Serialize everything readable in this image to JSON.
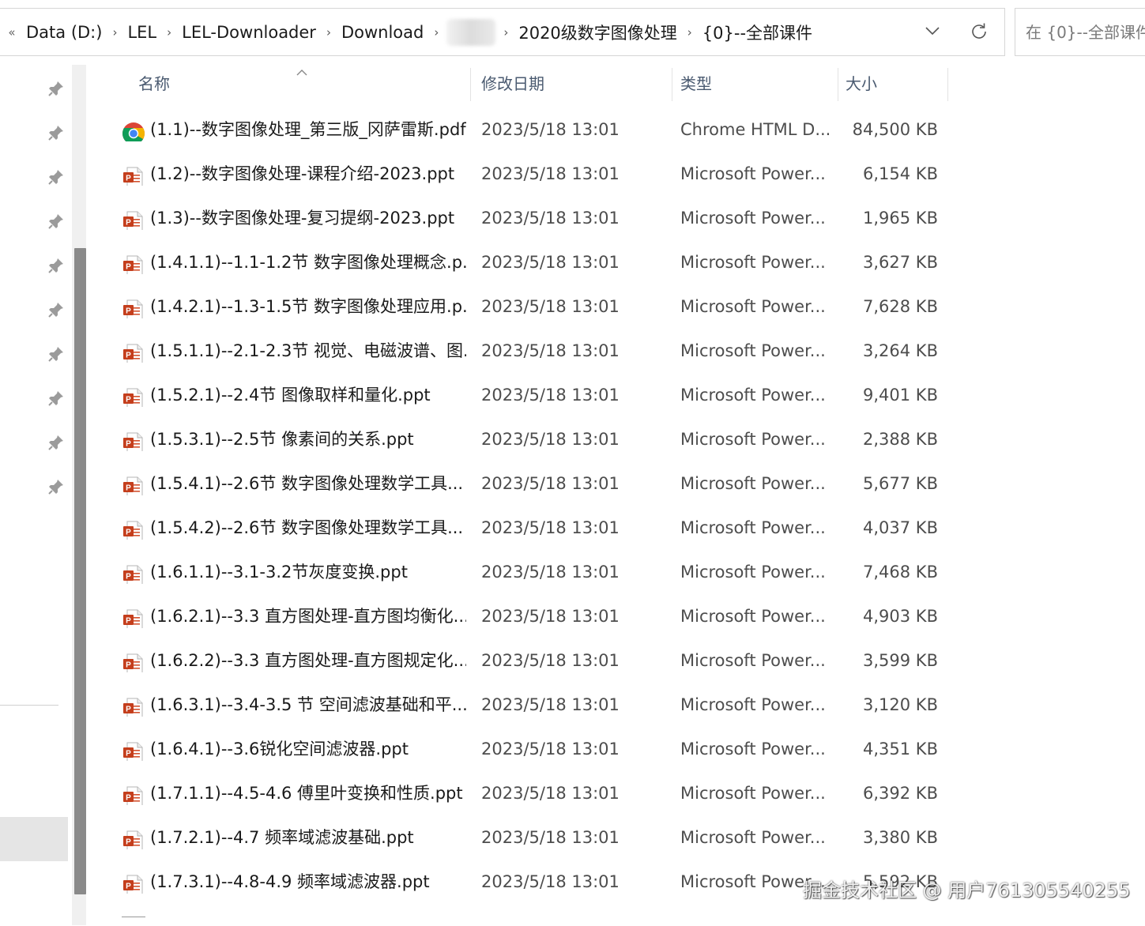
{
  "address_bar": {
    "crumbs": [
      "Data (D:)",
      "LEL",
      "LEL-Downloader",
      "Download",
      "",
      "2020级数字图像处理",
      "{0}--全部课件"
    ]
  },
  "search": {
    "placeholder": "在 {0}--全部课件"
  },
  "columns": {
    "name": "名称",
    "date": "修改日期",
    "type": "类型",
    "size": "大小"
  },
  "files": [
    {
      "icon": "chrome-pdf-icon",
      "name": "(1.1)--数字图像处理_第三版_冈萨雷斯.pdf",
      "date": "2023/5/18 13:01",
      "type": "Chrome HTML D...",
      "size": "84,500 KB"
    },
    {
      "icon": "powerpoint-file-icon",
      "name": "(1.2)--数字图像处理-课程介绍-2023.ppt",
      "date": "2023/5/18 13:01",
      "type": "Microsoft Power...",
      "size": "6,154 KB"
    },
    {
      "icon": "powerpoint-file-icon",
      "name": "(1.3)--数字图像处理-复习提纲-2023.ppt",
      "date": "2023/5/18 13:01",
      "type": "Microsoft Power...",
      "size": "1,965 KB"
    },
    {
      "icon": "powerpoint-file-icon",
      "name": "(1.4.1.1)--1.1-1.2节 数字图像处理概念.p...",
      "date": "2023/5/18 13:01",
      "type": "Microsoft Power...",
      "size": "3,627 KB"
    },
    {
      "icon": "powerpoint-file-icon",
      "name": "(1.4.2.1)--1.3-1.5节 数字图像处理应用.p...",
      "date": "2023/5/18 13:01",
      "type": "Microsoft Power...",
      "size": "7,628 KB"
    },
    {
      "icon": "powerpoint-file-icon",
      "name": "(1.5.1.1)--2.1-2.3节 视觉、电磁波谱、图...",
      "date": "2023/5/18 13:01",
      "type": "Microsoft Power...",
      "size": "3,264 KB"
    },
    {
      "icon": "powerpoint-file-icon",
      "name": "(1.5.2.1)--2.4节 图像取样和量化.ppt",
      "date": "2023/5/18 13:01",
      "type": "Microsoft Power...",
      "size": "9,401 KB"
    },
    {
      "icon": "powerpoint-file-icon",
      "name": "(1.5.3.1)--2.5节 像素间的关系.ppt",
      "date": "2023/5/18 13:01",
      "type": "Microsoft Power...",
      "size": "2,388 KB"
    },
    {
      "icon": "powerpoint-file-icon",
      "name": "(1.5.4.1)--2.6节 数字图像处理数学工具...",
      "date": "2023/5/18 13:01",
      "type": "Microsoft Power...",
      "size": "5,677 KB"
    },
    {
      "icon": "powerpoint-file-icon",
      "name": "(1.5.4.2)--2.6节 数字图像处理数学工具...",
      "date": "2023/5/18 13:01",
      "type": "Microsoft Power...",
      "size": "4,037 KB"
    },
    {
      "icon": "powerpoint-file-icon",
      "name": "(1.6.1.1)--3.1-3.2节灰度变换.ppt",
      "date": "2023/5/18 13:01",
      "type": "Microsoft Power...",
      "size": "7,468 KB"
    },
    {
      "icon": "powerpoint-file-icon",
      "name": "(1.6.2.1)--3.3 直方图处理-直方图均衡化....",
      "date": "2023/5/18 13:01",
      "type": "Microsoft Power...",
      "size": "4,903 KB"
    },
    {
      "icon": "powerpoint-file-icon",
      "name": "(1.6.2.2)--3.3 直方图处理-直方图规定化....",
      "date": "2023/5/18 13:01",
      "type": "Microsoft Power...",
      "size": "3,599 KB"
    },
    {
      "icon": "powerpoint-file-icon",
      "name": "(1.6.3.1)--3.4-3.5 节 空间滤波基础和平...",
      "date": "2023/5/18 13:01",
      "type": "Microsoft Power...",
      "size": "3,120 KB"
    },
    {
      "icon": "powerpoint-file-icon",
      "name": "(1.6.4.1)--3.6锐化空间滤波器.ppt",
      "date": "2023/5/18 13:01",
      "type": "Microsoft Power...",
      "size": "4,351 KB"
    },
    {
      "icon": "powerpoint-file-icon",
      "name": "(1.7.1.1)--4.5-4.6 傅里叶变换和性质.ppt",
      "date": "2023/5/18 13:01",
      "type": "Microsoft Power...",
      "size": "6,392 KB"
    },
    {
      "icon": "powerpoint-file-icon",
      "name": "(1.7.2.1)--4.7 频率域滤波基础.ppt",
      "date": "2023/5/18 13:01",
      "type": "Microsoft Power...",
      "size": "3,380 KB"
    },
    {
      "icon": "powerpoint-file-icon",
      "name": "(1.7.3.1)--4.8-4.9 频率域滤波器.ppt",
      "date": "2023/5/18 13:01",
      "type": "Microsoft Power...",
      "size": "5,592 KB"
    }
  ],
  "watermark": "掘金技术社区 @ 用户761305540255"
}
